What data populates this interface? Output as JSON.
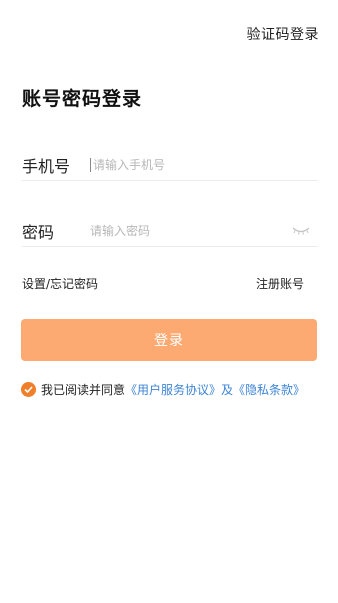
{
  "header": {
    "switch_login_label": "验证码登录"
  },
  "title": "账号密码登录",
  "phone": {
    "label": "手机号",
    "placeholder": "请输入手机号",
    "value": ""
  },
  "password": {
    "label": "密码",
    "placeholder": "请输入密码",
    "value": "",
    "toggle_icon": "eye-closed-icon"
  },
  "links": {
    "forgot": "设置/忘记密码",
    "register": "注册账号"
  },
  "login_button": {
    "label": "登录",
    "color": "#fcaa72"
  },
  "agreement": {
    "checked": true,
    "prefix": "我已阅读并同意",
    "user_agreement": "《用户服务协议》",
    "and": "及",
    "privacy": "《隐私条款》",
    "check_color": "#f07f2a",
    "link_color": "#3d84d6"
  }
}
